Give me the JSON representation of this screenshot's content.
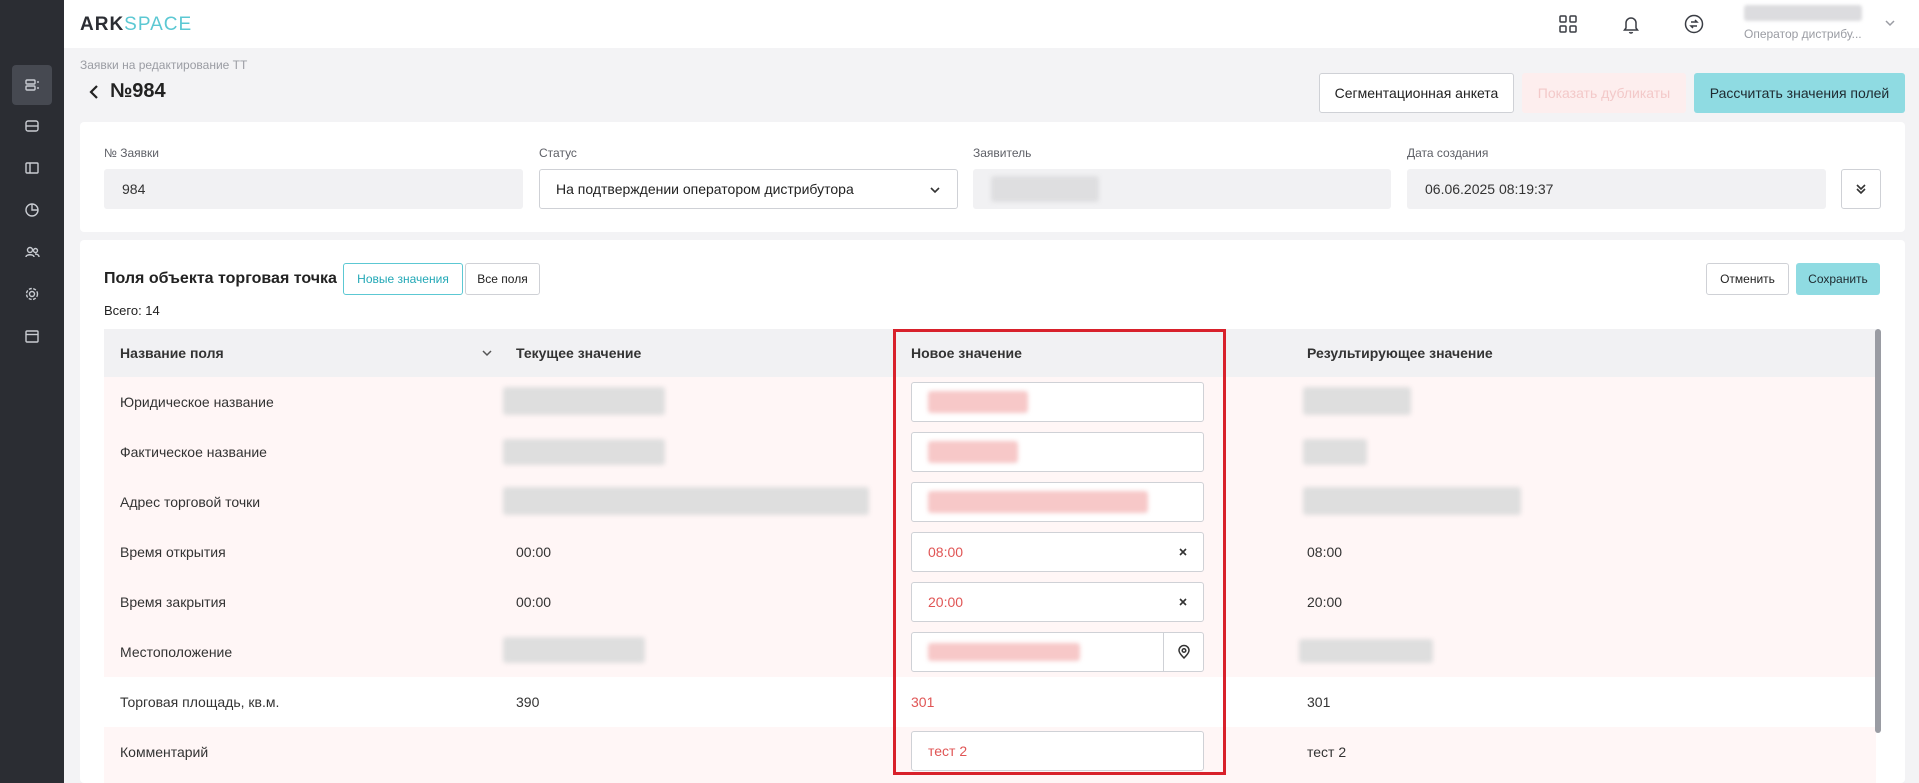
{
  "header": {
    "logo_ark": "ARK",
    "logo_space": "SPACE",
    "user_role": "Оператор дистрибу..."
  },
  "breadcrumb": "Заявки на редактирование ТТ",
  "page_title": "№984",
  "actions": {
    "segmentation": "Сегментационная анкета",
    "show_duplicates": "Показать дубликаты",
    "calculate": "Рассчитать значения полей"
  },
  "info": {
    "number_label": "№ Заявки",
    "number_value": "984",
    "status_label": "Статус",
    "status_value": "На подтверждении оператором дистрибутора",
    "applicant_label": "Заявитель",
    "created_label": "Дата создания",
    "created_value": "06.06.2025 08:19:37"
  },
  "section": {
    "title": "Поля объекта торговая точка",
    "toggle_new": "Новые значения",
    "toggle_all": "Все поля",
    "total": "Всего: 14",
    "cancel": "Отменить",
    "save": "Сохранить"
  },
  "table": {
    "columns": {
      "field": "Название поля",
      "current": "Текущее значение",
      "new": "Новое значение",
      "result": "Результирующее значение"
    },
    "rows": [
      {
        "field": "Юридическое название",
        "current": "",
        "new": "",
        "result": ""
      },
      {
        "field": "Фактическое название",
        "current": "",
        "new": "",
        "result": ""
      },
      {
        "field": "Адрес торговой точки",
        "current": "",
        "new": "",
        "result": ""
      },
      {
        "field": "Время открытия",
        "current": "00:00",
        "new": "08:00",
        "result": "08:00"
      },
      {
        "field": "Время закрытия",
        "current": "00:00",
        "new": "20:00",
        "result": "20:00"
      },
      {
        "field": "Местоположение",
        "current": "",
        "new": "",
        "result": ""
      },
      {
        "field": "Торговая площадь, кв.м.",
        "current": "390",
        "new": "301",
        "result": "301"
      },
      {
        "field": "Комментарий",
        "current": "",
        "new": "тест 2",
        "result": "тест 2"
      }
    ]
  }
}
